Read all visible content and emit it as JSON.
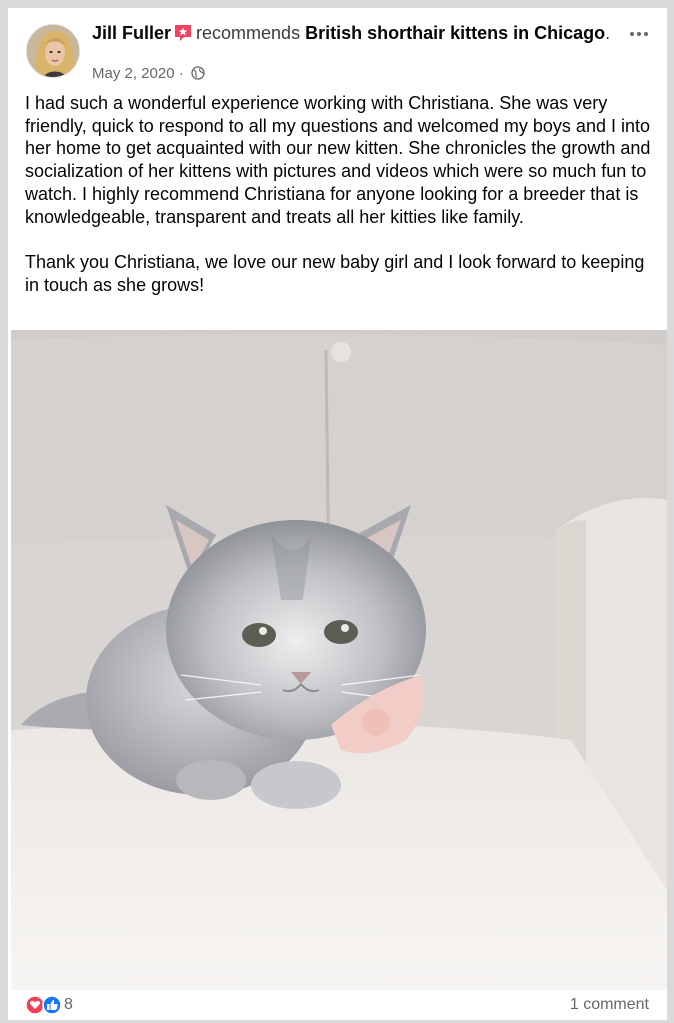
{
  "post": {
    "author": "Jill Fuller",
    "verb": "recommends",
    "page": "British shorthair kittens in Chicago",
    "date": "May 2, 2020",
    "date_separator": "·",
    "privacy_icon": "globe-icon",
    "more_icon": "more-icon",
    "body": "I had such a wonderful experience working with Christiana. She was very friendly, quick to respond to all my questions and welcomed my boys and I into her home to get acquainted with our new kitten. She chronicles the growth and socialization of her kittens with pictures and videos which were so much fun to watch. I highly recommend Christiana for anyone looking for a breeder that is knowledgeable, transparent and treats all her kitties like family.\n\nThank you Christiana, we love our new baby girl and I look forward to keeping in touch as she grows!"
  },
  "footer": {
    "reaction_icons": [
      "love-icon",
      "like-icon"
    ],
    "reaction_count": "8",
    "comments": "1 comment"
  },
  "colors": {
    "like": "#1877f2",
    "love": "#f33e58",
    "recommend": "#f3425f",
    "muted": "#65676b"
  }
}
